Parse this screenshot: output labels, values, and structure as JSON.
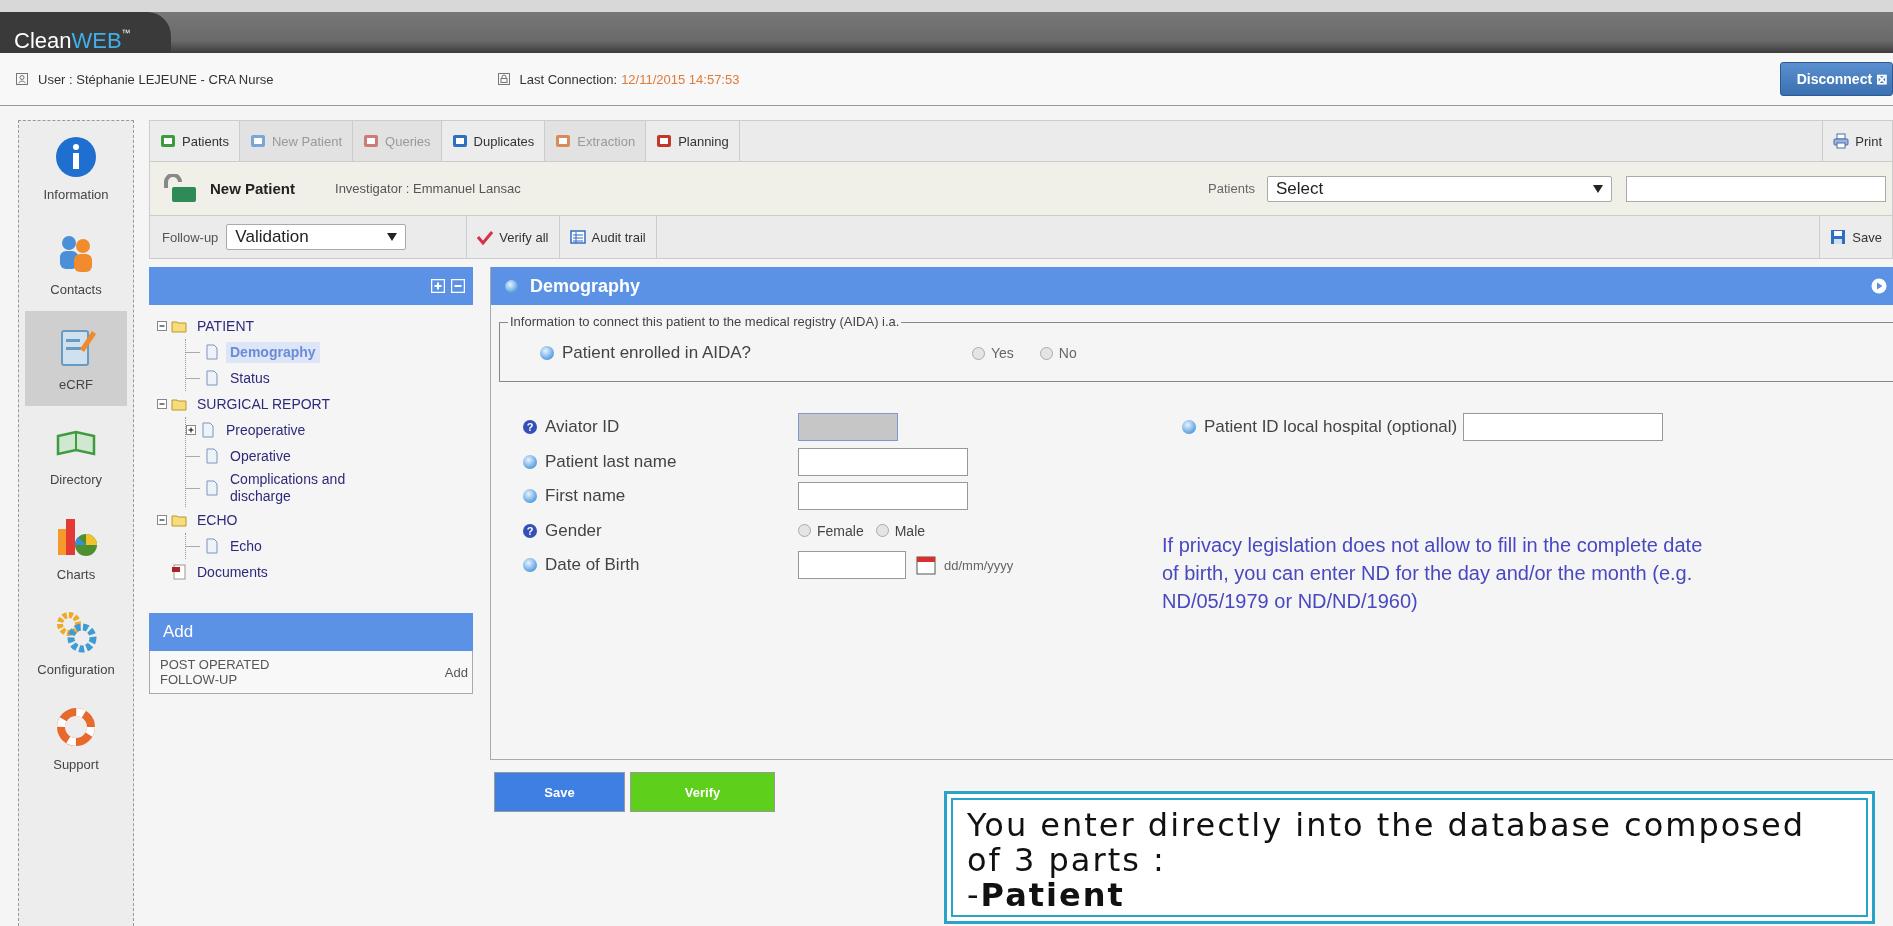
{
  "header": {
    "logo_main": "Clean",
    "logo_accent": "WEB",
    "logo_mark": "™"
  },
  "user_bar": {
    "user": "User :  Stéphanie LEJEUNE - CRA Nurse",
    "last_connection_label": "Last Connection:",
    "last_connection_value": "12/11/2015 14:57:53",
    "disconnect": "Disconnect",
    "disconnect_mark": "⊠"
  },
  "sidebar": {
    "items": [
      {
        "label": "Information",
        "kind": "info",
        "selected": false
      },
      {
        "label": "Contacts",
        "kind": "contacts",
        "selected": false
      },
      {
        "label": "eCRF",
        "kind": "ecrf",
        "selected": true
      },
      {
        "label": "Directory",
        "kind": "directory",
        "selected": false
      },
      {
        "label": "Charts",
        "kind": "charts",
        "selected": false
      },
      {
        "label": "Configuration",
        "kind": "config",
        "selected": false
      },
      {
        "label": "Support",
        "kind": "support",
        "selected": false
      }
    ]
  },
  "tabs": [
    {
      "label": "Patients",
      "kind": "patients",
      "disabled": false
    },
    {
      "label": "New Patient",
      "kind": "newpatient",
      "disabled": true
    },
    {
      "label": "Queries",
      "kind": "queries",
      "disabled": true
    },
    {
      "label": "Duplicates",
      "kind": "duplicates",
      "disabled": false
    },
    {
      "label": "Extraction",
      "kind": "extraction",
      "disabled": true
    },
    {
      "label": "Planning",
      "kind": "planning",
      "disabled": false
    }
  ],
  "print": "Print",
  "patient_bar": {
    "title": "New Patient",
    "investigator": "Investigator : Emmanuel Lansac",
    "patients_label": "Patients",
    "patients_select": "Select"
  },
  "follow_bar": {
    "label": "Follow-up",
    "value": "Validation",
    "verify_all": "Verify all",
    "audit_trail": "Audit trail",
    "save": "Save"
  },
  "tree": [
    {
      "label": "PATIENT",
      "kind": "folder",
      "expanded": true,
      "selected": false,
      "children": [
        {
          "label": "Demography",
          "kind": "page",
          "selected": true
        },
        {
          "label": "Status",
          "kind": "page",
          "selected": false
        }
      ]
    },
    {
      "label": "SURGICAL REPORT",
      "kind": "folder",
      "expanded": true,
      "selected": false,
      "children": [
        {
          "label": "Preoperative",
          "kind": "page",
          "expanded": false,
          "selected": false
        },
        {
          "label": "Operative",
          "kind": "page",
          "selected": false
        },
        {
          "label": "Complications and discharge",
          "kind": "page",
          "selected": false
        }
      ]
    },
    {
      "label": "ECHO",
      "kind": "folder",
      "expanded": true,
      "selected": false,
      "children": [
        {
          "label": "Echo",
          "kind": "page",
          "selected": false
        }
      ]
    },
    {
      "label": "Documents",
      "kind": "document",
      "selected": false
    }
  ],
  "add_panel": {
    "title": "Add",
    "rows": [
      {
        "label": "POST OPERATED FOLLOW-UP",
        "action": "Add"
      }
    ]
  },
  "form": {
    "title": "Demography",
    "legend": "Information to connect this patient to the medical registry (AIDA) i.a.",
    "question": {
      "label": "Patient enrolled in AIDA?",
      "options": [
        {
          "label": "Yes",
          "selected": false
        },
        {
          "label": "No",
          "selected": false
        }
      ]
    },
    "fields": [
      {
        "label": "Aviator ID",
        "help_mark": "?",
        "kind": "text",
        "disabled": true
      },
      {
        "label": "Patient last name",
        "kind": "text",
        "disabled": false
      },
      {
        "label": "First name",
        "kind": "text",
        "disabled": false
      },
      {
        "label": "Gender",
        "help_mark": "?",
        "kind": "radio",
        "options": [
          {
            "label": "Female",
            "selected": false
          },
          {
            "label": "Male",
            "selected": false
          }
        ]
      },
      {
        "label": "Date of Birth",
        "kind": "date",
        "hint": "dd/mm/yyyy"
      }
    ],
    "side_field": {
      "label": "Patient ID local hospital (optional)"
    },
    "note": "If privacy legislation does not allow to fill in the complete date of birth, you can enter ND for the day and/or the month (e.g. ND/05/1979 or ND/ND/1960)"
  },
  "buttons": [
    {
      "label": "Save",
      "kind": "save"
    },
    {
      "label": "Verify",
      "kind": "verify"
    }
  ],
  "callout": {
    "lines": [
      "You enter directly into the database composed of 3 parts :",
      "-**Patient**"
    ]
  }
}
